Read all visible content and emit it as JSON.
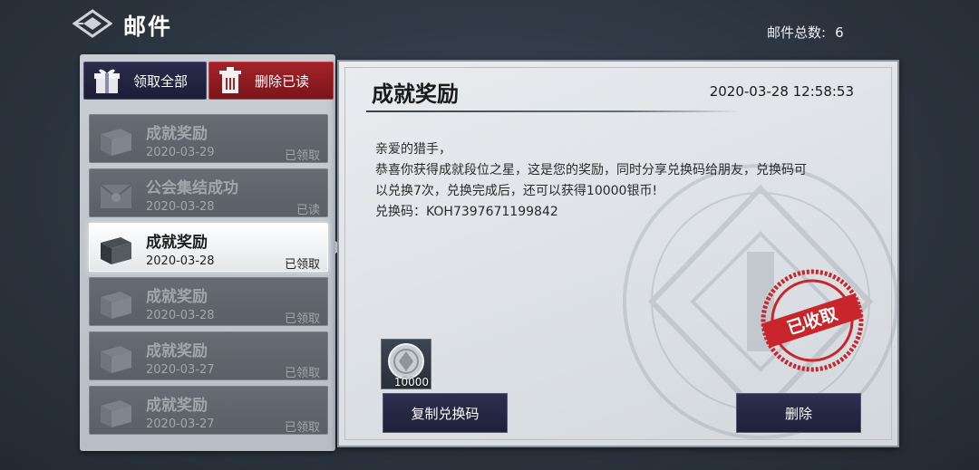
{
  "header": {
    "title": "邮件",
    "mail_count_label": "邮件总数:",
    "mail_count_value": "6"
  },
  "toolbar": {
    "claim_all_label": "领取全部",
    "delete_read_label": "删除已读"
  },
  "mail_list": [
    {
      "title": "成就奖励",
      "date": "2020-03-29",
      "status": "已领取",
      "icon": "box-icon"
    },
    {
      "title": "公会集结成功",
      "date": "2020-03-28",
      "status": "已读",
      "icon": "envelope-icon"
    },
    {
      "title": "成就奖励",
      "date": "2020-03-28",
      "status": "已领取",
      "icon": "box-icon",
      "selected": true
    },
    {
      "title": "成就奖励",
      "date": "2020-03-28",
      "status": "已领取",
      "icon": "box-icon"
    },
    {
      "title": "成就奖励",
      "date": "2020-03-27",
      "status": "已领取",
      "icon": "box-icon"
    },
    {
      "title": "成就奖励",
      "date": "2020-03-27",
      "status": "已领取",
      "icon": "box-icon"
    }
  ],
  "detail": {
    "title": "成就奖励",
    "datetime": "2020-03-28 12:58:53",
    "body": [
      "亲爱的猎手，",
      "恭喜你获得成就段位之星，这是您的奖励，同时分享兑换码给朋友，兑换码可",
      "以兑换7次，兑换完成后，还可以获得10000银币!",
      "兑换码：KOH7397671199842"
    ],
    "attachment": {
      "icon": "silver-coin-icon",
      "quantity": "10000"
    },
    "copy_code_label": "复制兑换码",
    "delete_label": "删除",
    "stamp_text": "已收取"
  },
  "colors": {
    "claim_button": "#1c1d36",
    "delete_read_button": "#a3232a",
    "stamp": "#c8262c"
  }
}
